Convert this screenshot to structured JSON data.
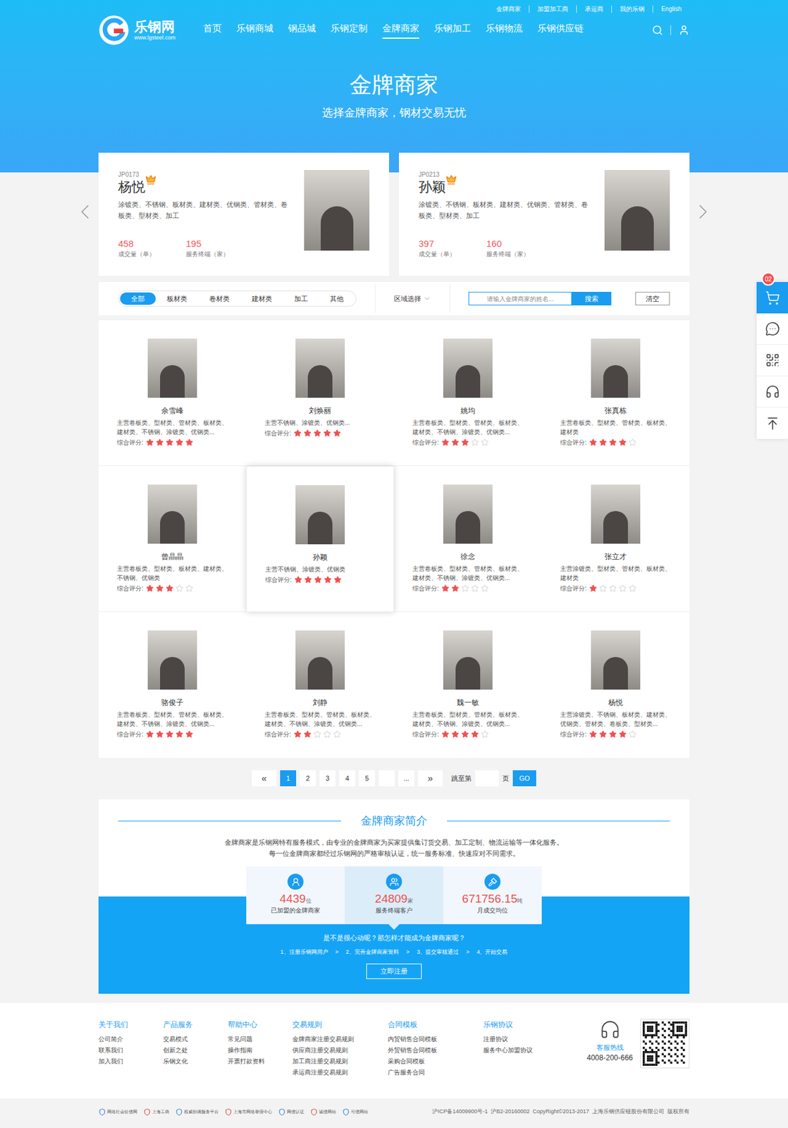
{
  "topLinks": [
    "金牌商家",
    "加盟加工商",
    "承运商",
    "我的乐钢",
    "English"
  ],
  "logo": {
    "name": "乐钢网",
    "url": "www.lgsteel.com"
  },
  "nav": [
    {
      "label": "首页",
      "selected": false
    },
    {
      "label": "乐钢商城",
      "selected": false
    },
    {
      "label": "钢品城",
      "selected": false
    },
    {
      "label": "乐钢定制",
      "selected": false
    },
    {
      "label": "金牌商家",
      "selected": true
    },
    {
      "label": "乐钢加工",
      "selected": false
    },
    {
      "label": "乐钢物流",
      "selected": false
    },
    {
      "label": "乐钢供应链",
      "selected": false
    }
  ],
  "hero": {
    "title": "金牌商家",
    "subtitle": "选择金牌商家，钢材交易无忧"
  },
  "featured": [
    {
      "code": "JP0173",
      "name": "杨悦",
      "categories": "涂镀类、不锈钢、板材类、建材类、优钢类、管材类、卷板类、型材类、加工",
      "stats": [
        {
          "value": "458",
          "label": "成交量（单）"
        },
        {
          "value": "195",
          "label": "服务终端（家）"
        }
      ]
    },
    {
      "code": "JP0213",
      "name": "孙颖",
      "categories": "涂镀类、不锈钢、板材类、建材类、优钢类、管材类、卷板类、型材类、加工",
      "stats": [
        {
          "value": "397",
          "label": "成交量（单）"
        },
        {
          "value": "160",
          "label": "服务终端（家）"
        }
      ]
    }
  ],
  "filter": {
    "tabs": [
      {
        "label": "全部",
        "selected": true
      },
      {
        "label": "板材类",
        "selected": false
      },
      {
        "label": "卷材类",
        "selected": false
      },
      {
        "label": "建材类",
        "selected": false
      },
      {
        "label": "加工",
        "selected": false
      },
      {
        "label": "其他",
        "selected": false
      }
    ],
    "region": "区域选择",
    "searchPlaceholder": "请输入金牌商家的姓名...",
    "searchButton": "搜索",
    "clearButton": "清空"
  },
  "ratingLabel": "综合评分:",
  "merchants": [
    {
      "name": "余雪峰",
      "categories": "主营卷板类、型材类、管材类、板材类、建材类、不锈钢、涂镀类、优钢类...",
      "stars": 5,
      "selected": false
    },
    {
      "name": "刘焕丽",
      "categories": "主营不锈钢、涂镀类、优钢类...",
      "stars": 5,
      "selected": false
    },
    {
      "name": "姚均",
      "categories": "主营卷板类、型材类、管材类、板材类、建材类、不锈钢、涂镀类、优钢类...",
      "stars": 3,
      "selected": false
    },
    {
      "name": "张真栋",
      "categories": "主营卷板类、型材类、管材类、板材类、建材类",
      "stars": 4,
      "selected": false
    },
    {
      "name": "曾晶晶",
      "categories": "主营卷板类、型材类、板材类、建材类、不锈钢、优钢类",
      "stars": 3,
      "selected": false
    },
    {
      "name": "孙颖",
      "categories": "主营不锈钢、涂镀类、优钢类",
      "stars": 5,
      "selected": true
    },
    {
      "name": "徐念",
      "categories": "主营卷板类、型材类、管材类、板材类、建材类、不锈钢、涂镀类、优钢类...",
      "stars": 2,
      "selected": false
    },
    {
      "name": "张立才",
      "categories": "主营涂镀类、型材类、管材类、板材类、建材类",
      "stars": 1,
      "selected": false
    },
    {
      "name": "骆俊子",
      "categories": "主营卷板类、型材类、管材类、板材类、建材类、不锈钢、涂镀类、优钢类...",
      "stars": 5,
      "selected": false
    },
    {
      "name": "刘静",
      "categories": "主营卷板类、型材类、管材类、板材类、建材类、不锈钢、涂镀类、优钢类...",
      "stars": 2,
      "selected": false
    },
    {
      "name": "魏一敏",
      "categories": "主营卷板类、型材类、管材类、板材类、建材类、不锈钢、涂镀类、优钢类...",
      "stars": 4,
      "selected": false
    },
    {
      "name": "杨悦",
      "categories": "主营涂镀类、不锈钢、板材类、建材类、优钢类、管材类、卷板类、型材类...",
      "stars": 4,
      "selected": false
    }
  ],
  "pagination": {
    "prev": "«",
    "next": "»",
    "pages": [
      {
        "label": "1",
        "selected": true
      },
      {
        "label": "2",
        "selected": false
      },
      {
        "label": "3",
        "selected": false
      },
      {
        "label": "4",
        "selected": false
      },
      {
        "label": "5",
        "selected": false
      },
      {
        "label": "",
        "selected": false
      },
      {
        "label": "...",
        "selected": false
      }
    ],
    "jumpLabel": "跳至第",
    "pageUnit": "页",
    "go": "GO"
  },
  "intro": {
    "title": "金牌商家简介",
    "lines": [
      "金牌商家是乐钢网特有服务模式，由专业的金牌商家为买家提供集订货交易、加工定制、物流运输等一体化服务。",
      "每一位金牌商家都经过乐钢网的严格审核认证，统一服务标准、快速应对不同需求。"
    ],
    "stats": [
      {
        "value": "4439",
        "unit": "位",
        "label": "已加盟的金牌商家",
        "selected": false
      },
      {
        "value": "24809",
        "unit": "家",
        "label": "服务终端客户",
        "selected": true
      },
      {
        "value": "671756.15",
        "unit": "吨",
        "label": "月成交均位",
        "selected": false
      }
    ],
    "question": "是不是很心动呢？那怎样才能成为金牌商家呢？",
    "steps": [
      "1、注册乐钢网用户",
      "2、完善金牌商家资料",
      "3、提交审核通过",
      "4、开始交易"
    ],
    "stepSeparator": ">",
    "register": "立即注册"
  },
  "sidebar": {
    "badge": "02"
  },
  "footer": {
    "columns": [
      {
        "title": "关于我们",
        "items": [
          "公司简介",
          "联系我们",
          "加入我们"
        ]
      },
      {
        "title": "产品服务",
        "items": [
          "交易模式",
          "创新之处",
          "乐钢文化"
        ]
      },
      {
        "title": "帮助中心",
        "items": [
          "常见问题",
          "操作指南",
          "开票打款资料"
        ]
      },
      {
        "title": "交易规则",
        "items": [
          "金牌商家注册交易规则",
          "供应商注册交易规则",
          "加工商注册交易规则",
          "承运商注册交易规则"
        ]
      },
      {
        "title": "合同模板",
        "items": [
          "内贸销售合同模板",
          "外贸销售合同模板",
          "采购合同模板",
          "广告服务合同"
        ]
      },
      {
        "title": "乐钢协议",
        "items": [
          "注册协议",
          "服务中心加盟协议"
        ]
      }
    ],
    "hotlineLabel": "客服热线",
    "hotline": "4008-200-666",
    "badges": [
      "网络社会征信网",
      "上海工商",
      "权威协调服务平台",
      "上海市网络举报中心",
      "网信认证",
      "诚信网站",
      "可信网站"
    ],
    "copyright": "沪ICP备14009900号-1  沪B2-20160002  CopyRight©2013-2017  上海乐钢供应链股份有限公司  版权所有"
  }
}
